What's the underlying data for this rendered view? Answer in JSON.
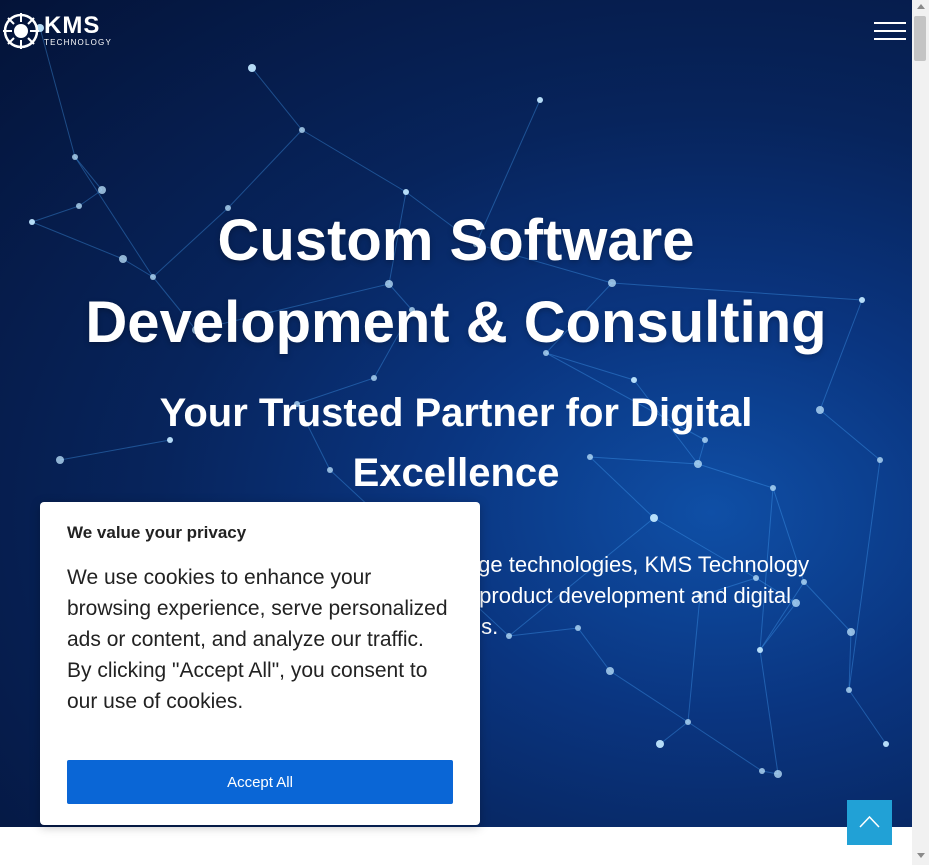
{
  "header": {
    "logo_text": "KMS",
    "logo_subtext": "TECHNOLOGY"
  },
  "hero": {
    "title_line1": "Custom Software",
    "title_line2": "Development & Consulting",
    "subtitle_line1": "Your Trusted Partner for Digital",
    "subtitle_line2": "Excellence",
    "lead_line1": "Th                                                  g-edge technologies, KMS Technology",
    "lead_line2": "i                                                 ware product development and digital",
    "lead_line3": "n needs."
  },
  "consent": {
    "title": "We value your privacy",
    "body": "We use cookies to enhance your browsing experience, serve personalized ads or content, and analyze our traffic. By clicking \"Accept All\", you consent to our use of cookies.",
    "accept_label": "Accept All"
  },
  "icons": {
    "menu": "hamburger-icon",
    "back_to_top": "chevron-up-icon"
  },
  "colors": {
    "hero_bg": "#07245c",
    "accept_button": "#0a66d6",
    "back_to_top": "#21a1d6"
  }
}
